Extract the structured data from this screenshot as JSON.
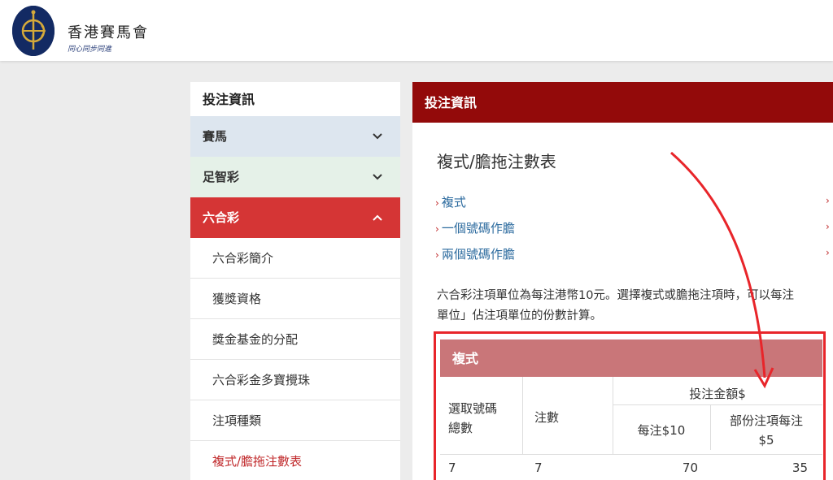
{
  "header": {
    "brand_name": "香港賽馬會",
    "tagline": "同心同步同進"
  },
  "sidebar": {
    "title": "投注資訊",
    "sections": [
      {
        "label": "賽馬",
        "chevron": "chevron-down-icon"
      },
      {
        "label": "足智彩",
        "chevron": "chevron-down-icon"
      },
      {
        "label": "六合彩",
        "chevron": "chevron-up-icon"
      }
    ],
    "sub_items": [
      "六合彩簡介",
      "獲獎資格",
      "獎金基金的分配",
      "六合彩金多寶攪珠",
      "注項種類",
      "複式/膽拖注數表"
    ]
  },
  "main": {
    "header_title": "投注資訊",
    "page_title": "複式/膽拖注數表",
    "links": [
      "複式",
      "一個號碼作膽",
      "兩個號碼作膽"
    ],
    "paragraph_line1": "六合彩注項單位為每注港幣10元。選擇複式或膽拖注項時，可以每注",
    "paragraph_line2": "單位」佔注項單位的份數計算。",
    "table": {
      "title": "複式",
      "col_numbers_line1": "選取號碼",
      "col_numbers_line2": "總數",
      "col_bets": "注數",
      "col_amount_group": "投注金額$",
      "col_per10": "每注$10",
      "col_partial_line1": "部份注項每注",
      "col_partial_line2": "$5",
      "rows": [
        {
          "numbers": "7",
          "bets": "7",
          "per10": "70",
          "partial": "35"
        }
      ]
    }
  },
  "colors": {
    "main_header": "#930a0a",
    "mark6_active": "#d53535",
    "table_header": "#c97679",
    "highlight": "#e8252a",
    "link": "#2b6a9e"
  }
}
